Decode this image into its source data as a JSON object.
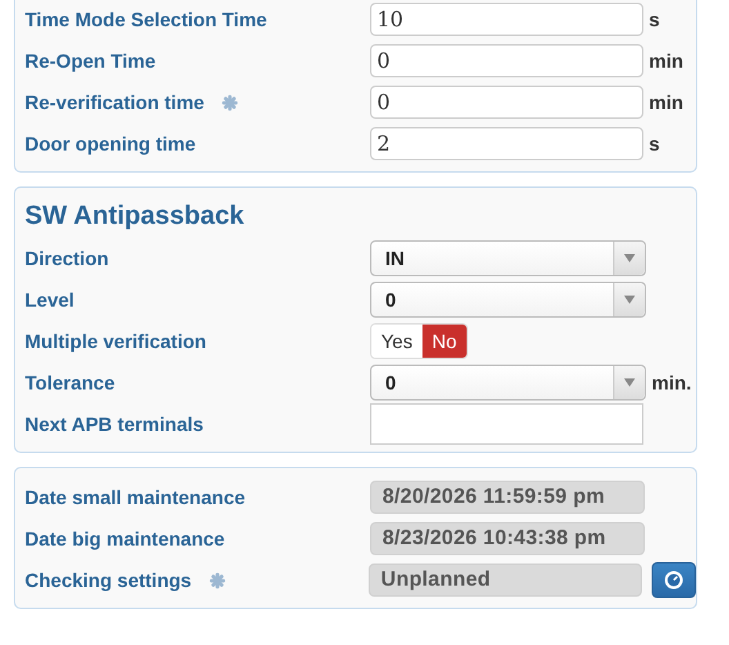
{
  "sections": [
    {
      "rows": [
        {
          "kind": "text",
          "label": "Time Mode Selection Time",
          "value": "10",
          "unit": "s"
        },
        {
          "kind": "text",
          "label": "Re-Open Time",
          "value": "0",
          "unit": "min"
        },
        {
          "kind": "text",
          "label": "Re-verification time",
          "value": "0",
          "unit": "min",
          "info": true
        },
        {
          "kind": "text",
          "label": "Door opening time",
          "value": "2",
          "unit": "s"
        }
      ]
    },
    {
      "title": "SW Antipassback",
      "rows": [
        {
          "kind": "select",
          "label": "Direction",
          "value": "IN"
        },
        {
          "kind": "select",
          "label": "Level",
          "value": "0"
        },
        {
          "kind": "toggle",
          "label": "Multiple verification",
          "options": [
            {
              "label": "Yes",
              "selected": false
            },
            {
              "label": "No",
              "selected": true
            }
          ]
        },
        {
          "kind": "select",
          "label": "Tolerance",
          "value": "0",
          "unit": "min."
        },
        {
          "kind": "box",
          "label": "Next APB terminals"
        }
      ]
    },
    {
      "rows": [
        {
          "kind": "readonly",
          "label": "Date small maintenance",
          "value": "8/20/2026 11:59:59 pm"
        },
        {
          "kind": "readonly",
          "label": "Date big maintenance",
          "value": "8/23/2026 10:43:38 pm"
        },
        {
          "kind": "readonly",
          "label": "Checking settings",
          "value": "Unplanned",
          "info": true,
          "action": true
        }
      ]
    }
  ]
}
